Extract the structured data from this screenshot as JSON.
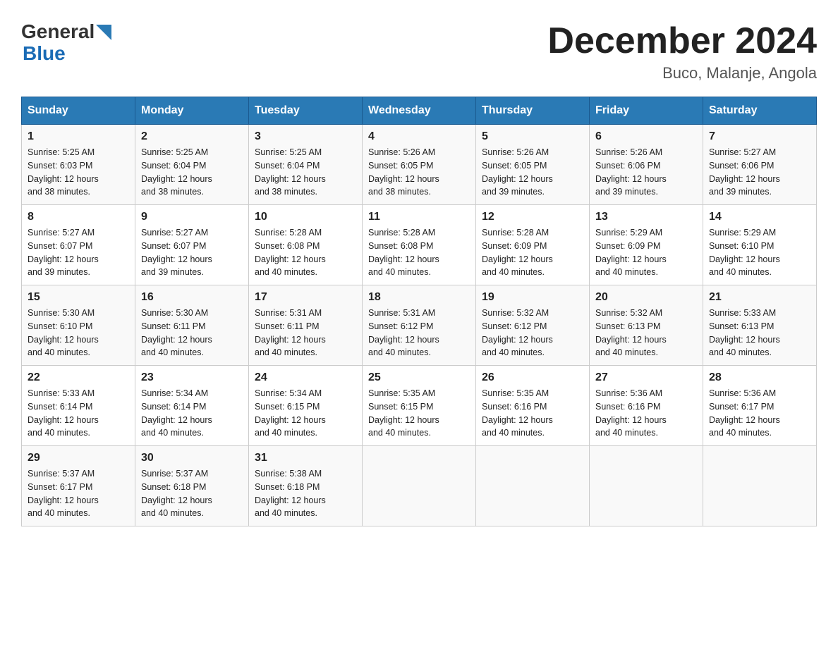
{
  "header": {
    "logo_general": "General",
    "logo_blue": "Blue",
    "title": "December 2024",
    "subtitle": "Buco, Malanje, Angola"
  },
  "columns": [
    "Sunday",
    "Monday",
    "Tuesday",
    "Wednesday",
    "Thursday",
    "Friday",
    "Saturday"
  ],
  "weeks": [
    [
      {
        "day": "1",
        "sunrise": "5:25 AM",
        "sunset": "6:03 PM",
        "daylight": "12 hours and 38 minutes."
      },
      {
        "day": "2",
        "sunrise": "5:25 AM",
        "sunset": "6:04 PM",
        "daylight": "12 hours and 38 minutes."
      },
      {
        "day": "3",
        "sunrise": "5:25 AM",
        "sunset": "6:04 PM",
        "daylight": "12 hours and 38 minutes."
      },
      {
        "day": "4",
        "sunrise": "5:26 AM",
        "sunset": "6:05 PM",
        "daylight": "12 hours and 38 minutes."
      },
      {
        "day": "5",
        "sunrise": "5:26 AM",
        "sunset": "6:05 PM",
        "daylight": "12 hours and 39 minutes."
      },
      {
        "day": "6",
        "sunrise": "5:26 AM",
        "sunset": "6:06 PM",
        "daylight": "12 hours and 39 minutes."
      },
      {
        "day": "7",
        "sunrise": "5:27 AM",
        "sunset": "6:06 PM",
        "daylight": "12 hours and 39 minutes."
      }
    ],
    [
      {
        "day": "8",
        "sunrise": "5:27 AM",
        "sunset": "6:07 PM",
        "daylight": "12 hours and 39 minutes."
      },
      {
        "day": "9",
        "sunrise": "5:27 AM",
        "sunset": "6:07 PM",
        "daylight": "12 hours and 39 minutes."
      },
      {
        "day": "10",
        "sunrise": "5:28 AM",
        "sunset": "6:08 PM",
        "daylight": "12 hours and 40 minutes."
      },
      {
        "day": "11",
        "sunrise": "5:28 AM",
        "sunset": "6:08 PM",
        "daylight": "12 hours and 40 minutes."
      },
      {
        "day": "12",
        "sunrise": "5:28 AM",
        "sunset": "6:09 PM",
        "daylight": "12 hours and 40 minutes."
      },
      {
        "day": "13",
        "sunrise": "5:29 AM",
        "sunset": "6:09 PM",
        "daylight": "12 hours and 40 minutes."
      },
      {
        "day": "14",
        "sunrise": "5:29 AM",
        "sunset": "6:10 PM",
        "daylight": "12 hours and 40 minutes."
      }
    ],
    [
      {
        "day": "15",
        "sunrise": "5:30 AM",
        "sunset": "6:10 PM",
        "daylight": "12 hours and 40 minutes."
      },
      {
        "day": "16",
        "sunrise": "5:30 AM",
        "sunset": "6:11 PM",
        "daylight": "12 hours and 40 minutes."
      },
      {
        "day": "17",
        "sunrise": "5:31 AM",
        "sunset": "6:11 PM",
        "daylight": "12 hours and 40 minutes."
      },
      {
        "day": "18",
        "sunrise": "5:31 AM",
        "sunset": "6:12 PM",
        "daylight": "12 hours and 40 minutes."
      },
      {
        "day": "19",
        "sunrise": "5:32 AM",
        "sunset": "6:12 PM",
        "daylight": "12 hours and 40 minutes."
      },
      {
        "day": "20",
        "sunrise": "5:32 AM",
        "sunset": "6:13 PM",
        "daylight": "12 hours and 40 minutes."
      },
      {
        "day": "21",
        "sunrise": "5:33 AM",
        "sunset": "6:13 PM",
        "daylight": "12 hours and 40 minutes."
      }
    ],
    [
      {
        "day": "22",
        "sunrise": "5:33 AM",
        "sunset": "6:14 PM",
        "daylight": "12 hours and 40 minutes."
      },
      {
        "day": "23",
        "sunrise": "5:34 AM",
        "sunset": "6:14 PM",
        "daylight": "12 hours and 40 minutes."
      },
      {
        "day": "24",
        "sunrise": "5:34 AM",
        "sunset": "6:15 PM",
        "daylight": "12 hours and 40 minutes."
      },
      {
        "day": "25",
        "sunrise": "5:35 AM",
        "sunset": "6:15 PM",
        "daylight": "12 hours and 40 minutes."
      },
      {
        "day": "26",
        "sunrise": "5:35 AM",
        "sunset": "6:16 PM",
        "daylight": "12 hours and 40 minutes."
      },
      {
        "day": "27",
        "sunrise": "5:36 AM",
        "sunset": "6:16 PM",
        "daylight": "12 hours and 40 minutes."
      },
      {
        "day": "28",
        "sunrise": "5:36 AM",
        "sunset": "6:17 PM",
        "daylight": "12 hours and 40 minutes."
      }
    ],
    [
      {
        "day": "29",
        "sunrise": "5:37 AM",
        "sunset": "6:17 PM",
        "daylight": "12 hours and 40 minutes."
      },
      {
        "day": "30",
        "sunrise": "5:37 AM",
        "sunset": "6:18 PM",
        "daylight": "12 hours and 40 minutes."
      },
      {
        "day": "31",
        "sunrise": "5:38 AM",
        "sunset": "6:18 PM",
        "daylight": "12 hours and 40 minutes."
      },
      null,
      null,
      null,
      null
    ]
  ],
  "labels": {
    "sunrise": "Sunrise:",
    "sunset": "Sunset:",
    "daylight": "Daylight:"
  }
}
